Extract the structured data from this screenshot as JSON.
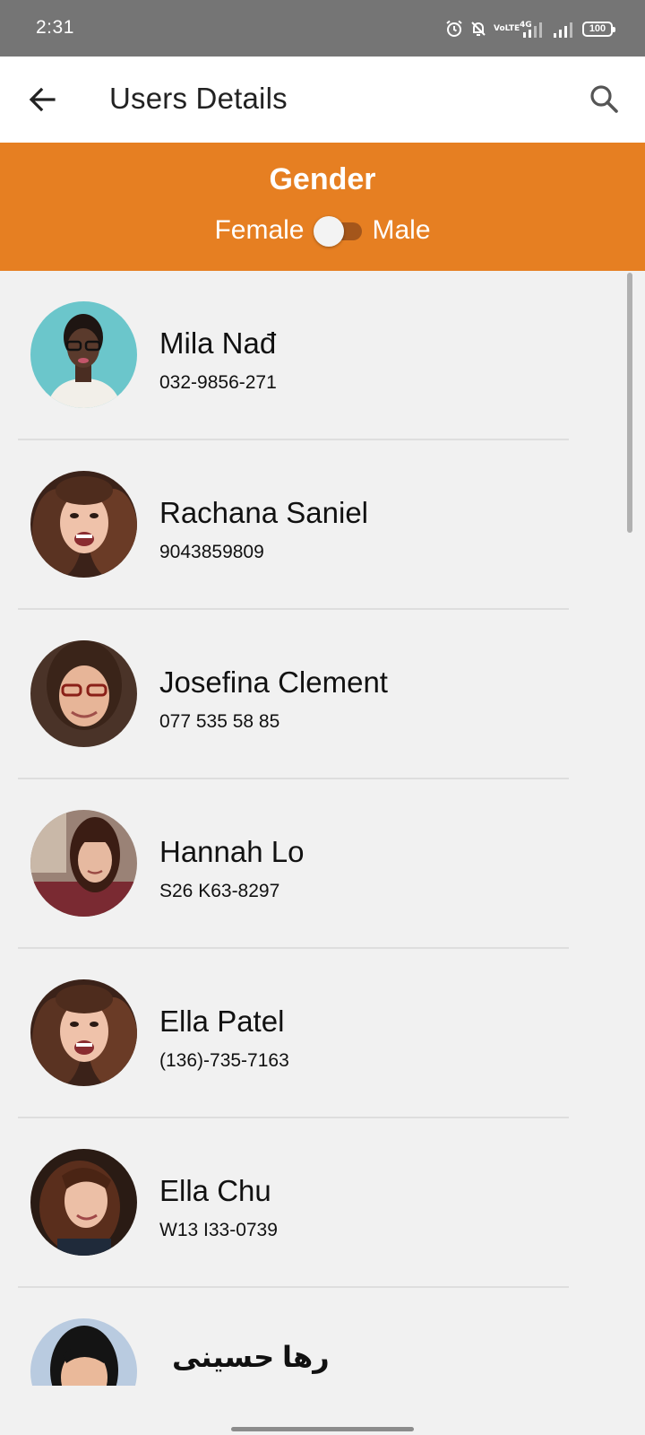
{
  "status_bar": {
    "time": "2:31",
    "volte_label": "VoLTE",
    "network_label": "4G",
    "battery": "100"
  },
  "app_bar": {
    "title": "Users Details"
  },
  "gender_filter": {
    "title": "Gender",
    "left_label": "Female",
    "right_label": "Male",
    "selected": "Female"
  },
  "colors": {
    "accent": "#e67f22",
    "app_bar_bg": "#ffffff",
    "list_bg": "#f1f1f1",
    "status_bar_bg": "#757575"
  },
  "users": [
    {
      "name": "Mila Nađ",
      "phone": "032-9856-271"
    },
    {
      "name": "Rachana Saniel",
      "phone": "9043859809"
    },
    {
      "name": "Josefina Clement",
      "phone": "077 535 58 85"
    },
    {
      "name": "Hannah Lo",
      "phone": "S26 K63-8297"
    },
    {
      "name": "Ella Patel",
      "phone": "(136)-735-7163"
    },
    {
      "name": "Ella Chu",
      "phone": "W13 I33-0739"
    },
    {
      "name": "رها حسینی",
      "phone": ""
    }
  ]
}
